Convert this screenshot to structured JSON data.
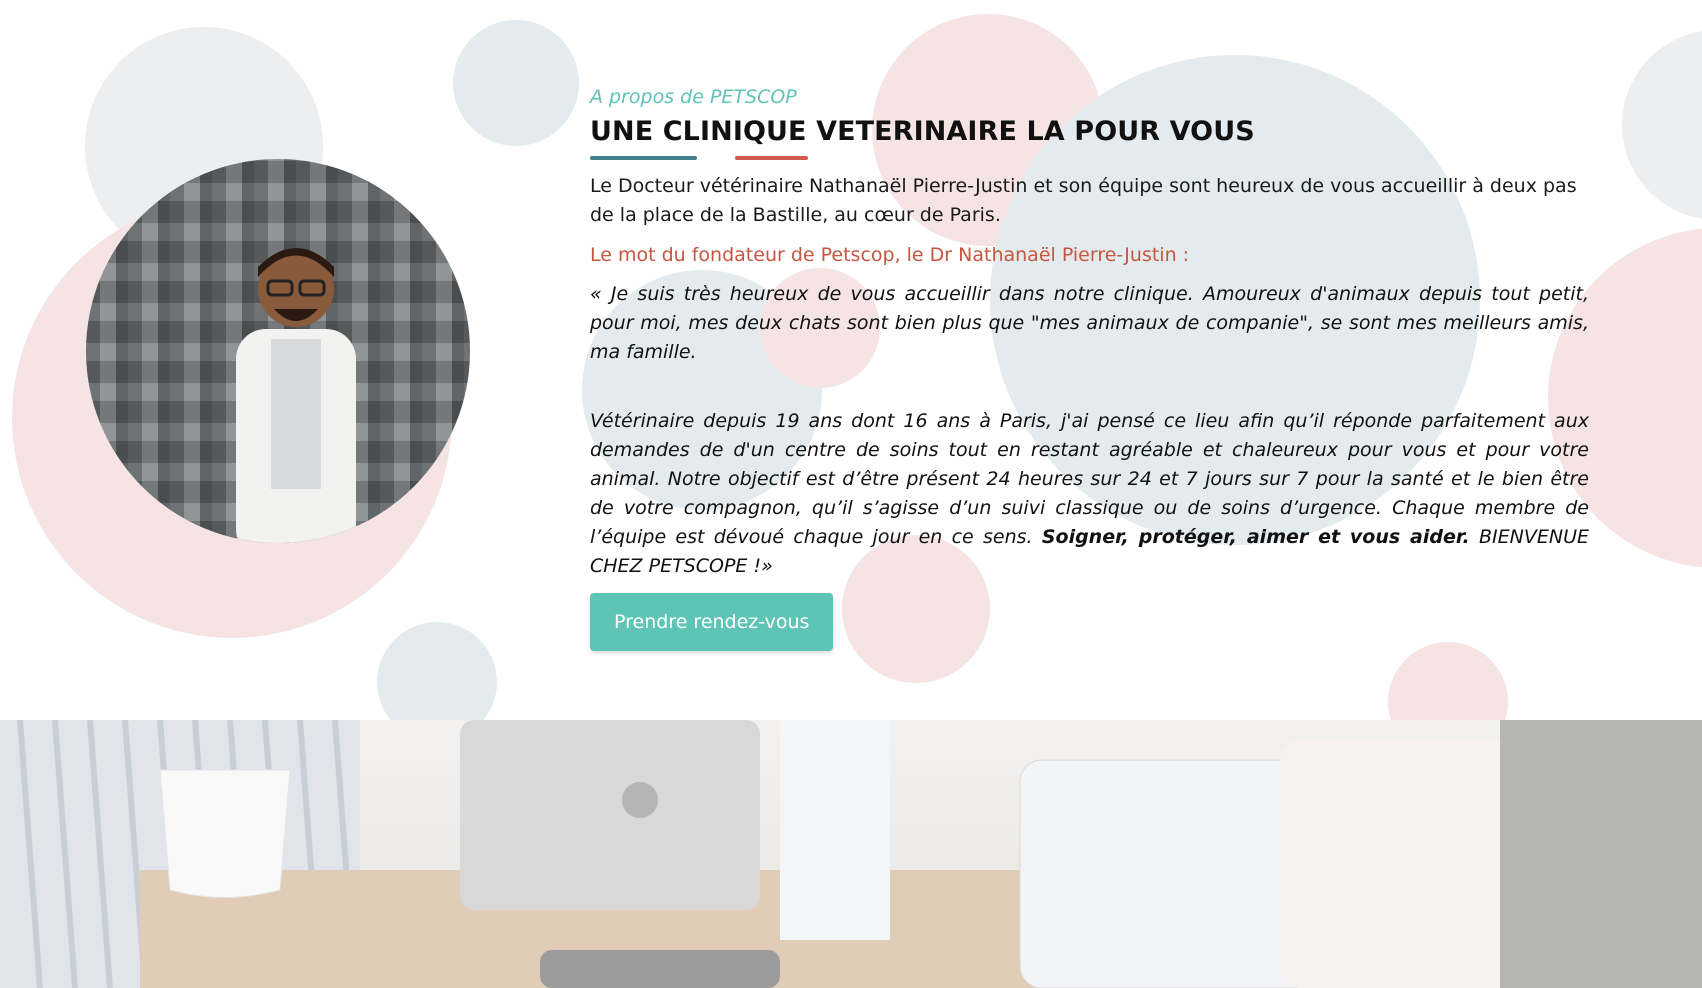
{
  "about": {
    "eyebrow": "A propos de PETSCOP",
    "title": "UNE CLINIQUE VETERINAIRE LA POUR VOUS",
    "intro": "Le Docteur vétérinaire Nathanaël Pierre-Justin et son équipe sont heureux de vous accueillir à deux pas de la place de la Bastille, au cœur de Paris.",
    "founder_heading": "Le mot du fondateur de Petscop, le Dr Nathanaël Pierre-Justin :",
    "quote_p1": "« Je suis très heureux de vous accueillir dans notre clinique. Amoureux d'animaux depuis tout petit, pour moi, mes deux chats sont bien plus que \"mes animaux de companie\", se sont mes meilleurs amis, ma famille.",
    "quote_p2_start": "Vétérinaire depuis 19 ans dont 16 ans à Paris, j'ai pensé ce lieu afin qu’il réponde parfaitement aux demandes de d'un centre de soins tout en restant agréable et chaleureux pour vous et pour votre animal. Notre objectif est d’être présent 24 heures sur 24 et 7 jours sur 7 pour la santé et le bien être de votre compagnon, qu’il s’agisse d’un suivi classique ou de soins d’urgence. Chaque membre de l’équipe est dévoué chaque jour en ce sens. ",
    "quote_p2_bold": "Soigner, protéger, aimer et vous aider.",
    "quote_p2_end": " BIENVENUE CHEZ PETSCOPE !»",
    "cta_label": "Prendre rendez-vous"
  },
  "colors": {
    "accent_teal": "#5ec4b6",
    "accent_red": "#c8553f",
    "underline_blue": "#43808a",
    "underline_red": "#cf5c4c"
  }
}
